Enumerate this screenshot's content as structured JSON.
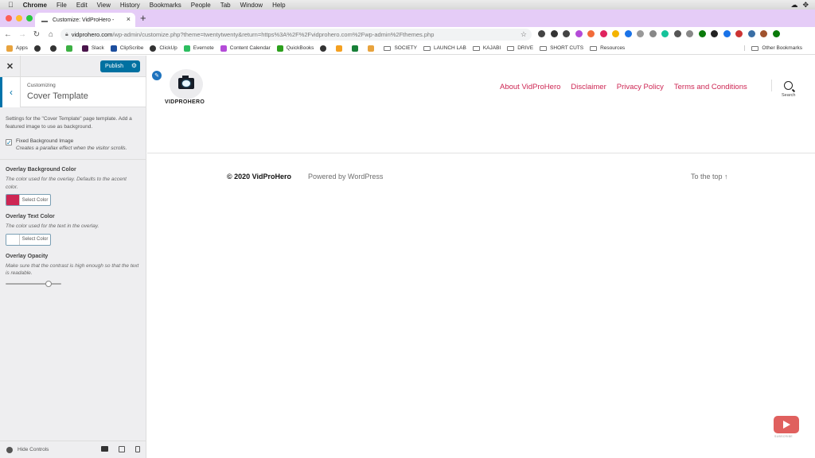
{
  "menubar": {
    "app": "Chrome",
    "items": [
      "File",
      "Edit",
      "View",
      "History",
      "Bookmarks",
      "People",
      "Tab",
      "Window",
      "Help"
    ]
  },
  "browser": {
    "tab_title": "Customize: VidProHero -",
    "url_host": "vidprohero.com",
    "url_path": "/wp-admin/customize.php?theme=twentytwenty&return=https%3A%2F%2Fvidprohero.com%2Fwp-admin%2Fthemes.php",
    "bookmarks": [
      {
        "label": "Apps",
        "icon": "apps-grid-icon",
        "color": "#e8a33d"
      },
      {
        "label": "",
        "icon": "globe-icon",
        "color": "#333333"
      },
      {
        "label": "",
        "icon": "globe-icon",
        "color": "#333333"
      },
      {
        "label": "",
        "icon": "green-diamond-icon",
        "color": "#3cb043"
      },
      {
        "label": "Slack",
        "icon": "slack-icon",
        "color": "#4a154b"
      },
      {
        "label": "ClipScribe",
        "icon": "clipscribe-icon",
        "color": "#1d4e9e"
      },
      {
        "label": "ClickUp",
        "icon": "globe-icon",
        "color": "#333333"
      },
      {
        "label": "Evernote",
        "icon": "evernote-icon",
        "color": "#2dbe60"
      },
      {
        "label": "Content Calendar",
        "icon": "calendar-icon",
        "color": "#b44bd8"
      },
      {
        "label": "QuickBooks",
        "icon": "quickbooks-icon",
        "color": "#2ca01c"
      },
      {
        "label": "",
        "icon": "globe-icon",
        "color": "#333333"
      },
      {
        "label": "",
        "icon": "emoji-icon",
        "color": "#f4a020"
      },
      {
        "label": "",
        "icon": "sheets-icon",
        "color": "#188038"
      },
      {
        "label": "",
        "icon": "bookmark-icon",
        "color": "#e8a33d"
      },
      {
        "label": "SOCIETY",
        "icon": "folder-icon",
        "color": ""
      },
      {
        "label": "LAUNCH LAB",
        "icon": "folder-icon",
        "color": ""
      },
      {
        "label": "KAJABI",
        "icon": "folder-icon",
        "color": ""
      },
      {
        "label": "DRIVE",
        "icon": "folder-icon",
        "color": ""
      },
      {
        "label": "SHORT CUTS",
        "icon": "folder-icon",
        "color": ""
      },
      {
        "label": "Resources",
        "icon": "folder-icon",
        "color": ""
      }
    ],
    "other_bookmarks": "Other Bookmarks",
    "extension_colors": [
      "#444444",
      "#333333",
      "#444444",
      "#b44bd8",
      "#f26b3a",
      "#e0245e",
      "#f4b400",
      "#1a73e8",
      "#999999",
      "#888888",
      "#15c39a",
      "#555555",
      "#888888",
      "#0a7a0a",
      "#222222",
      "#1a73e8",
      "#cc3333",
      "#3a6ea5",
      "#a0522d",
      "#0a7a0a"
    ]
  },
  "customizer": {
    "publish_label": "Publish",
    "breadcrumb_sup": "Customizing",
    "section_title": "Cover Template",
    "section_desc": "Settings for the \"Cover Template\" page template. Add a featured image to use as background.",
    "fixed_bg": {
      "label": "Fixed Background Image",
      "desc": "Creates a parallax effect when the visitor scrolls.",
      "checked": true
    },
    "overlay_bg": {
      "title": "Overlay Background Color",
      "desc": "The color used for the overlay. Defaults to the accent color.",
      "button": "Select Color",
      "color": "#cd2653"
    },
    "overlay_text": {
      "title": "Overlay Text Color",
      "desc": "The color used for the text in the overlay.",
      "button": "Select Color",
      "color": "#ffffff"
    },
    "overlay_opacity": {
      "title": "Overlay Opacity",
      "desc": "Make sure that the contrast is high enough so that the text is readable.",
      "value_fraction": 0.8
    },
    "hide_controls": "Hide Controls"
  },
  "site": {
    "logo_text": "VIDPROHERO",
    "nav": [
      "About VidProHero",
      "Disclaimer",
      "Privacy Policy",
      "Terms and Conditions"
    ],
    "search_label": "Search",
    "copyright": "© 2020 VidProHero",
    "powered": "Powered by WordPress",
    "to_top": "To the top ↑",
    "accent": "#cd2653",
    "subscribe_label": "SUBSCRIBE"
  }
}
